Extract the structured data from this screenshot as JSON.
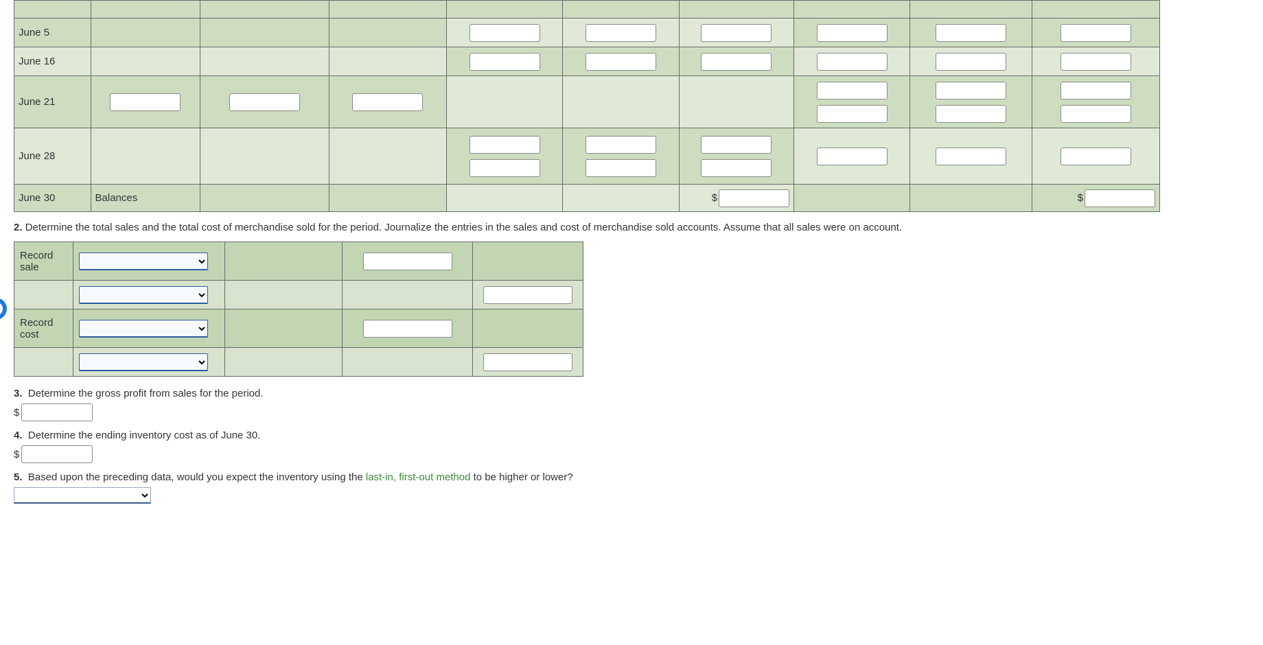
{
  "table1": {
    "rows": [
      {
        "date": "June 5",
        "label": ""
      },
      {
        "date": "June 16",
        "label": ""
      },
      {
        "date": "June 21",
        "label": ""
      },
      {
        "date": "June 28",
        "label": ""
      },
      {
        "date": "June 30",
        "label": "Balances"
      }
    ],
    "dollar": "$"
  },
  "q2": {
    "num": "2.",
    "text": "Determine the total sales and the total cost of merchandise sold for the period. Journalize the entries in the sales and cost of merchandise sold accounts. Assume that all sales were on account."
  },
  "journal": {
    "row1_label": "Record sale",
    "row3_label": "Record cost"
  },
  "q3": {
    "num": "3.",
    "text": "Determine the gross profit from sales for the period.",
    "dollar": "$"
  },
  "q4": {
    "num": "4.",
    "text": "Determine the ending inventory cost as of June 30.",
    "dollar": "$"
  },
  "q5": {
    "num": "5.",
    "text_a": "Based upon the preceding data, would you expect the inventory using the ",
    "link": "last-in, first-out method",
    "text_b": " to be higher or lower?"
  }
}
